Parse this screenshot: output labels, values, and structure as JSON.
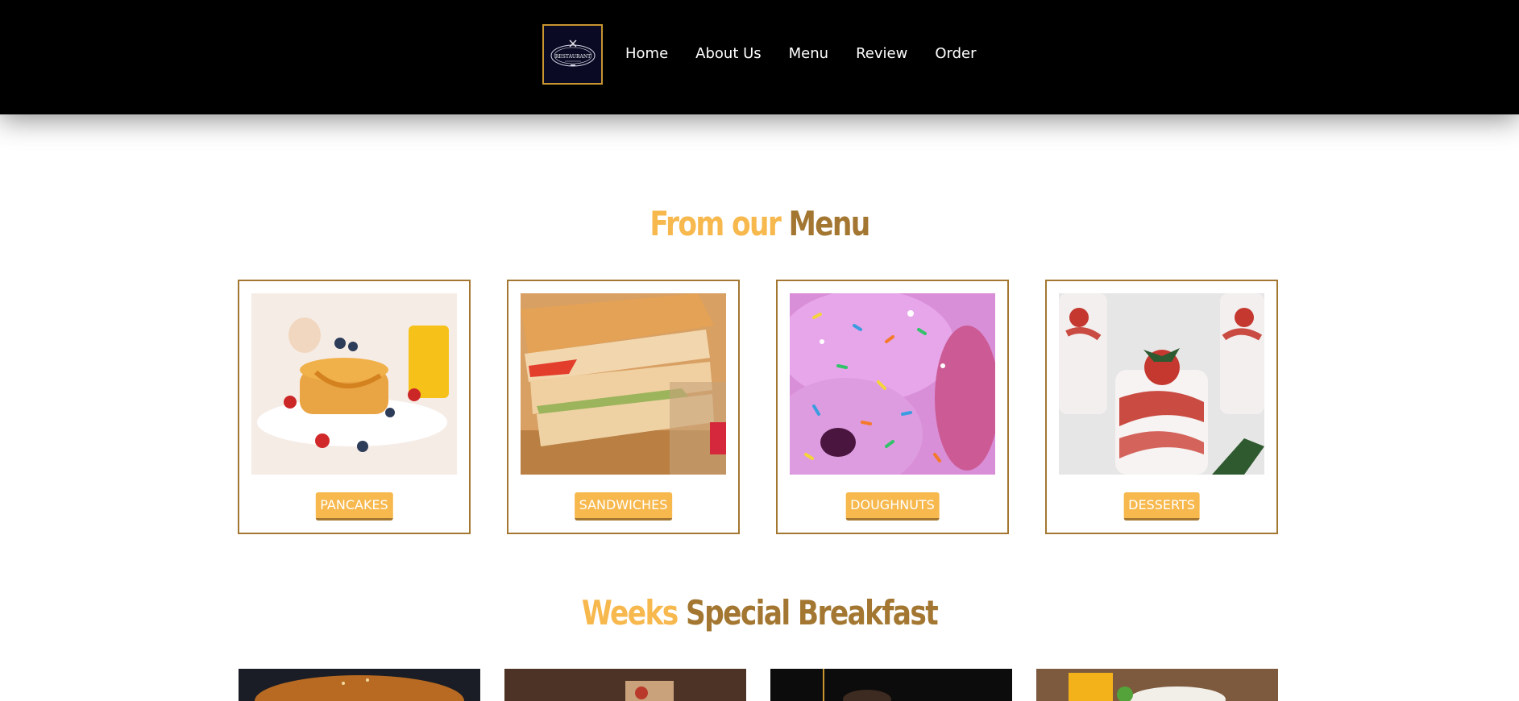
{
  "header": {
    "logo_text": "RESTAURANT",
    "nav": [
      "Home",
      "About Us",
      "Menu",
      "Review",
      "Order"
    ]
  },
  "menu_section": {
    "title_light": "From our",
    "title_dark": "Menu",
    "cards": [
      {
        "label": "PANCAKES"
      },
      {
        "label": "SANDWICHES"
      },
      {
        "label": "DOUGHNUTS"
      },
      {
        "label": "DESSERTS"
      }
    ]
  },
  "special_section": {
    "title_light": "Weeks",
    "title_dark": "Special Breakfast"
  },
  "colors": {
    "accent_light": "#f7b84d",
    "accent_dark": "#a37731",
    "nav_bg": "#000000"
  }
}
